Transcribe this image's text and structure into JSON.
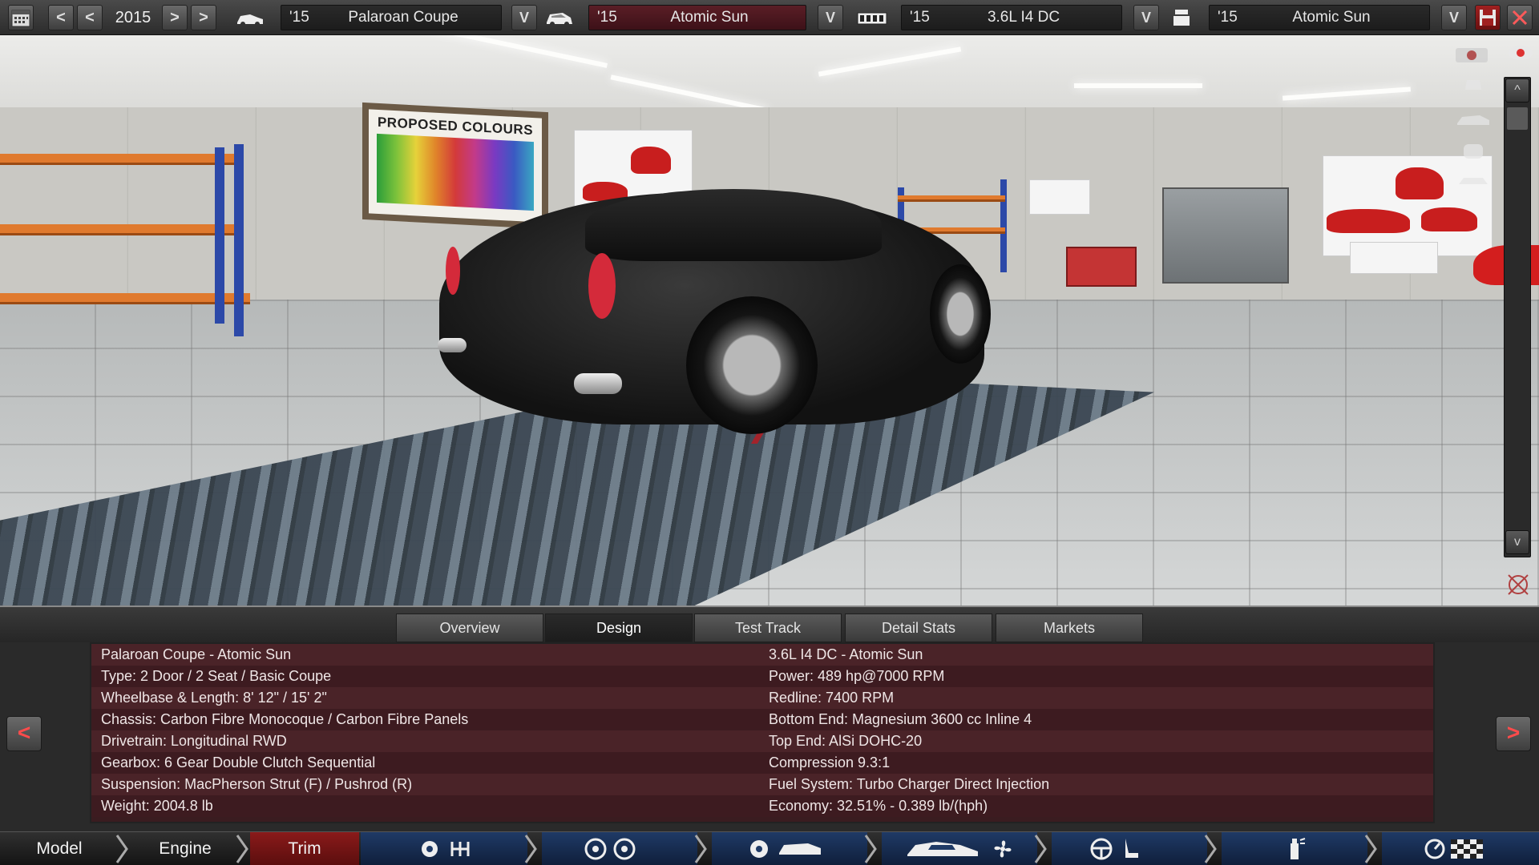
{
  "topbar": {
    "year": "2015",
    "nav_buttons": {
      "first": "<",
      "prev": "<",
      "next": ">",
      "last": ">"
    },
    "dropdown_glyph": "V",
    "model": {
      "year": "'15",
      "name": "Palaroan Coupe"
    },
    "trim": {
      "year": "'15",
      "name": "Atomic Sun"
    },
    "engine": {
      "year": "'15",
      "name": "3.6L I4 DC"
    },
    "engine_variant": {
      "year": "'15",
      "name": "Atomic Sun"
    },
    "icons": [
      "calendar-icon",
      "car-model-icon",
      "car-trim-icon",
      "engine-icon",
      "engine-variant-icon",
      "save-icon",
      "close-icon"
    ]
  },
  "viewport": {
    "poster_title": "PROPOSED COLOURS",
    "scroll_up": "^",
    "scroll_down": "v"
  },
  "tabs": [
    {
      "label": "Overview",
      "active": false
    },
    {
      "label": "Design",
      "active": true
    },
    {
      "label": "Test Track",
      "active": false
    },
    {
      "label": "Detail Stats",
      "active": false
    },
    {
      "label": "Markets",
      "active": false
    }
  ],
  "info": {
    "left": [
      "Palaroan Coupe - Atomic Sun",
      "Type: 2 Door / 2 Seat / Basic Coupe",
      "Wheelbase & Length: 8' 12\" / 15' 2\"",
      "Chassis: Carbon Fibre Monocoque / Carbon Fibre Panels",
      "Drivetrain: Longitudinal RWD",
      "Gearbox: 6 Gear Double Clutch Sequential",
      "Suspension: MacPherson Strut (F) / Pushrod (R)",
      "Weight: 2004.8 lb"
    ],
    "right": [
      "3.6L I4 DC - Atomic Sun",
      "Power: 489 hp@7000 RPM",
      "Redline: 7400 RPM",
      "Bottom End: Magnesium 3600 cc Inline 4",
      "Top End: AlSi DOHC-20",
      "Compression 9.3:1",
      "Fuel System: Turbo Charger Direct Injection",
      "Economy: 32.51% - 0.389 lb/(hph)"
    ],
    "prev_label": "<",
    "next_label": ">"
  },
  "bottom_nav": {
    "model": "Model",
    "engine": "Engine",
    "trim": "Trim"
  },
  "colors": {
    "accent_red": "#8a1a1a",
    "panel_bg": "#3a1c20",
    "arrow_red": "#ff4b4b"
  }
}
